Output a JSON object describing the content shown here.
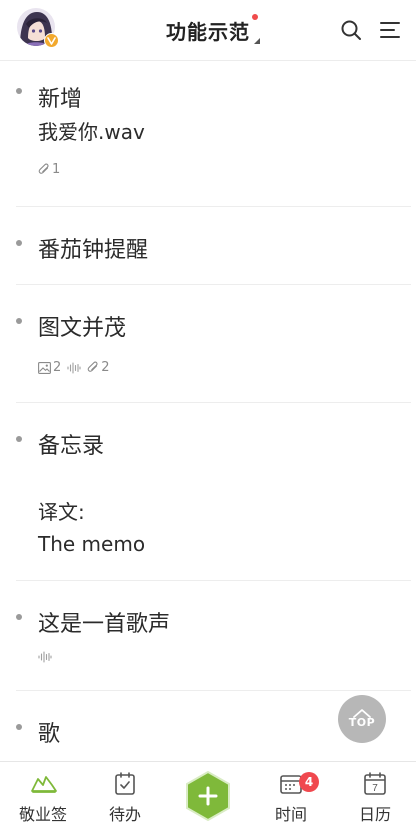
{
  "header": {
    "title": "功能示范"
  },
  "notes": [
    {
      "title": "新增",
      "body": [
        "我爱你.wav"
      ],
      "attachments": "1"
    },
    {
      "title": "番茄钟提醒"
    },
    {
      "title": "图文并茂",
      "images": "2",
      "attachments": "2"
    },
    {
      "title": "备忘录",
      "body": [
        "译文:",
        "The memo"
      ]
    },
    {
      "title": "这是一首歌声"
    },
    {
      "title": "歌"
    }
  ],
  "top_button": {
    "label": "TOP"
  },
  "tabbar": {
    "tabs": [
      {
        "label": "敬业签"
      },
      {
        "label": "待办"
      },
      {
        "label": "时间",
        "badge": "4"
      },
      {
        "label": "日历",
        "calendar_day": "7"
      }
    ]
  },
  "colors": {
    "accent_green": "#7fb93a",
    "badge_red": "#f0484e",
    "avatar_badge": "#f2a92e"
  },
  "icons": {
    "header": [
      "search-icon",
      "menu-icon"
    ],
    "meta": [
      "paperclip-icon",
      "image-icon",
      "audio-wave-icon"
    ],
    "tabs": [
      "bird-icon",
      "checklist-icon",
      "plus-icon",
      "clock-calendar-icon",
      "calendar-icon"
    ]
  }
}
